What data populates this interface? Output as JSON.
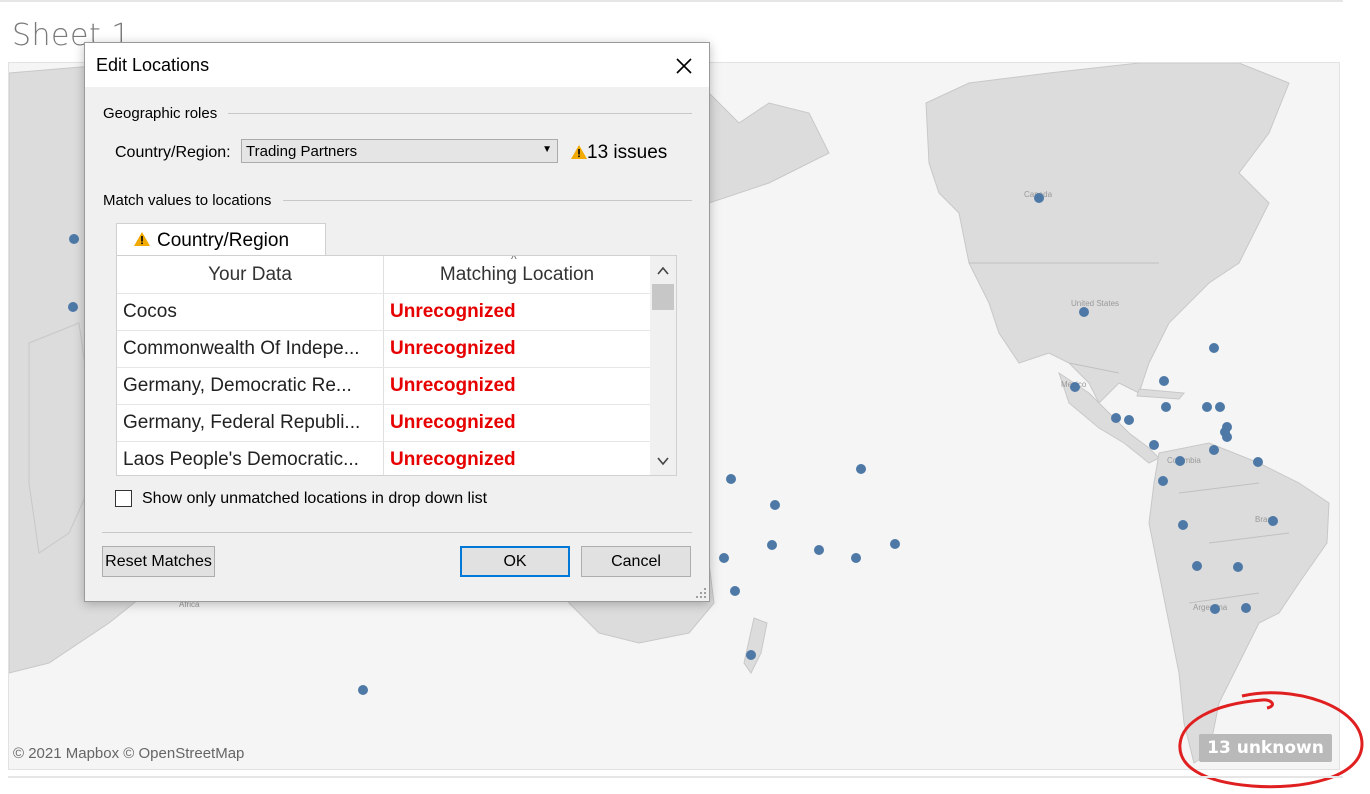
{
  "sheet": {
    "title": "Sheet 1"
  },
  "map": {
    "copyright": "© 2021 Mapbox © OpenStreetMap",
    "unknown_badge": "13 unknown",
    "point_color": "#4e79a7",
    "land_color": "#dcdcdc",
    "water_color": "#f5f5f5",
    "annotation_color": "#e02020",
    "labels": {
      "canada": "Canada",
      "usa": "United States",
      "mexico": "Mexico",
      "colombia": "Colombia",
      "brazil": "Brasil",
      "argentina": "Argentina",
      "africa": "Africa"
    }
  },
  "dialog": {
    "title": "Edit Locations",
    "geographic_roles_label": "Geographic roles",
    "country_region_field_label": "Country/Region:",
    "country_region_value": "Trading Partners",
    "issues_text": "13 issues",
    "match_values_label": "Match values to locations",
    "tab_label": "Country/Region",
    "table": {
      "columns": [
        "Your Data",
        "Matching Location"
      ],
      "rows": [
        {
          "data": "Cocos",
          "match": "Unrecognized"
        },
        {
          "data": "Commonwealth Of Indepe...",
          "match": "Unrecognized"
        },
        {
          "data": "Germany, Democratic Re...",
          "match": "Unrecognized"
        },
        {
          "data": "Germany, Federal Republi...",
          "match": "Unrecognized"
        },
        {
          "data": "Laos People's Democratic...",
          "match": "Unrecognized"
        }
      ]
    },
    "show_unmatched_label": "Show only unmatched locations in drop down list",
    "show_unmatched_checked": false,
    "buttons": {
      "reset": "Reset Matches",
      "ok": "OK",
      "cancel": "Cancel"
    },
    "warning_color": "#f2a900",
    "unrecognized_color": "#e60000",
    "ok_border_color": "#0078d7"
  }
}
